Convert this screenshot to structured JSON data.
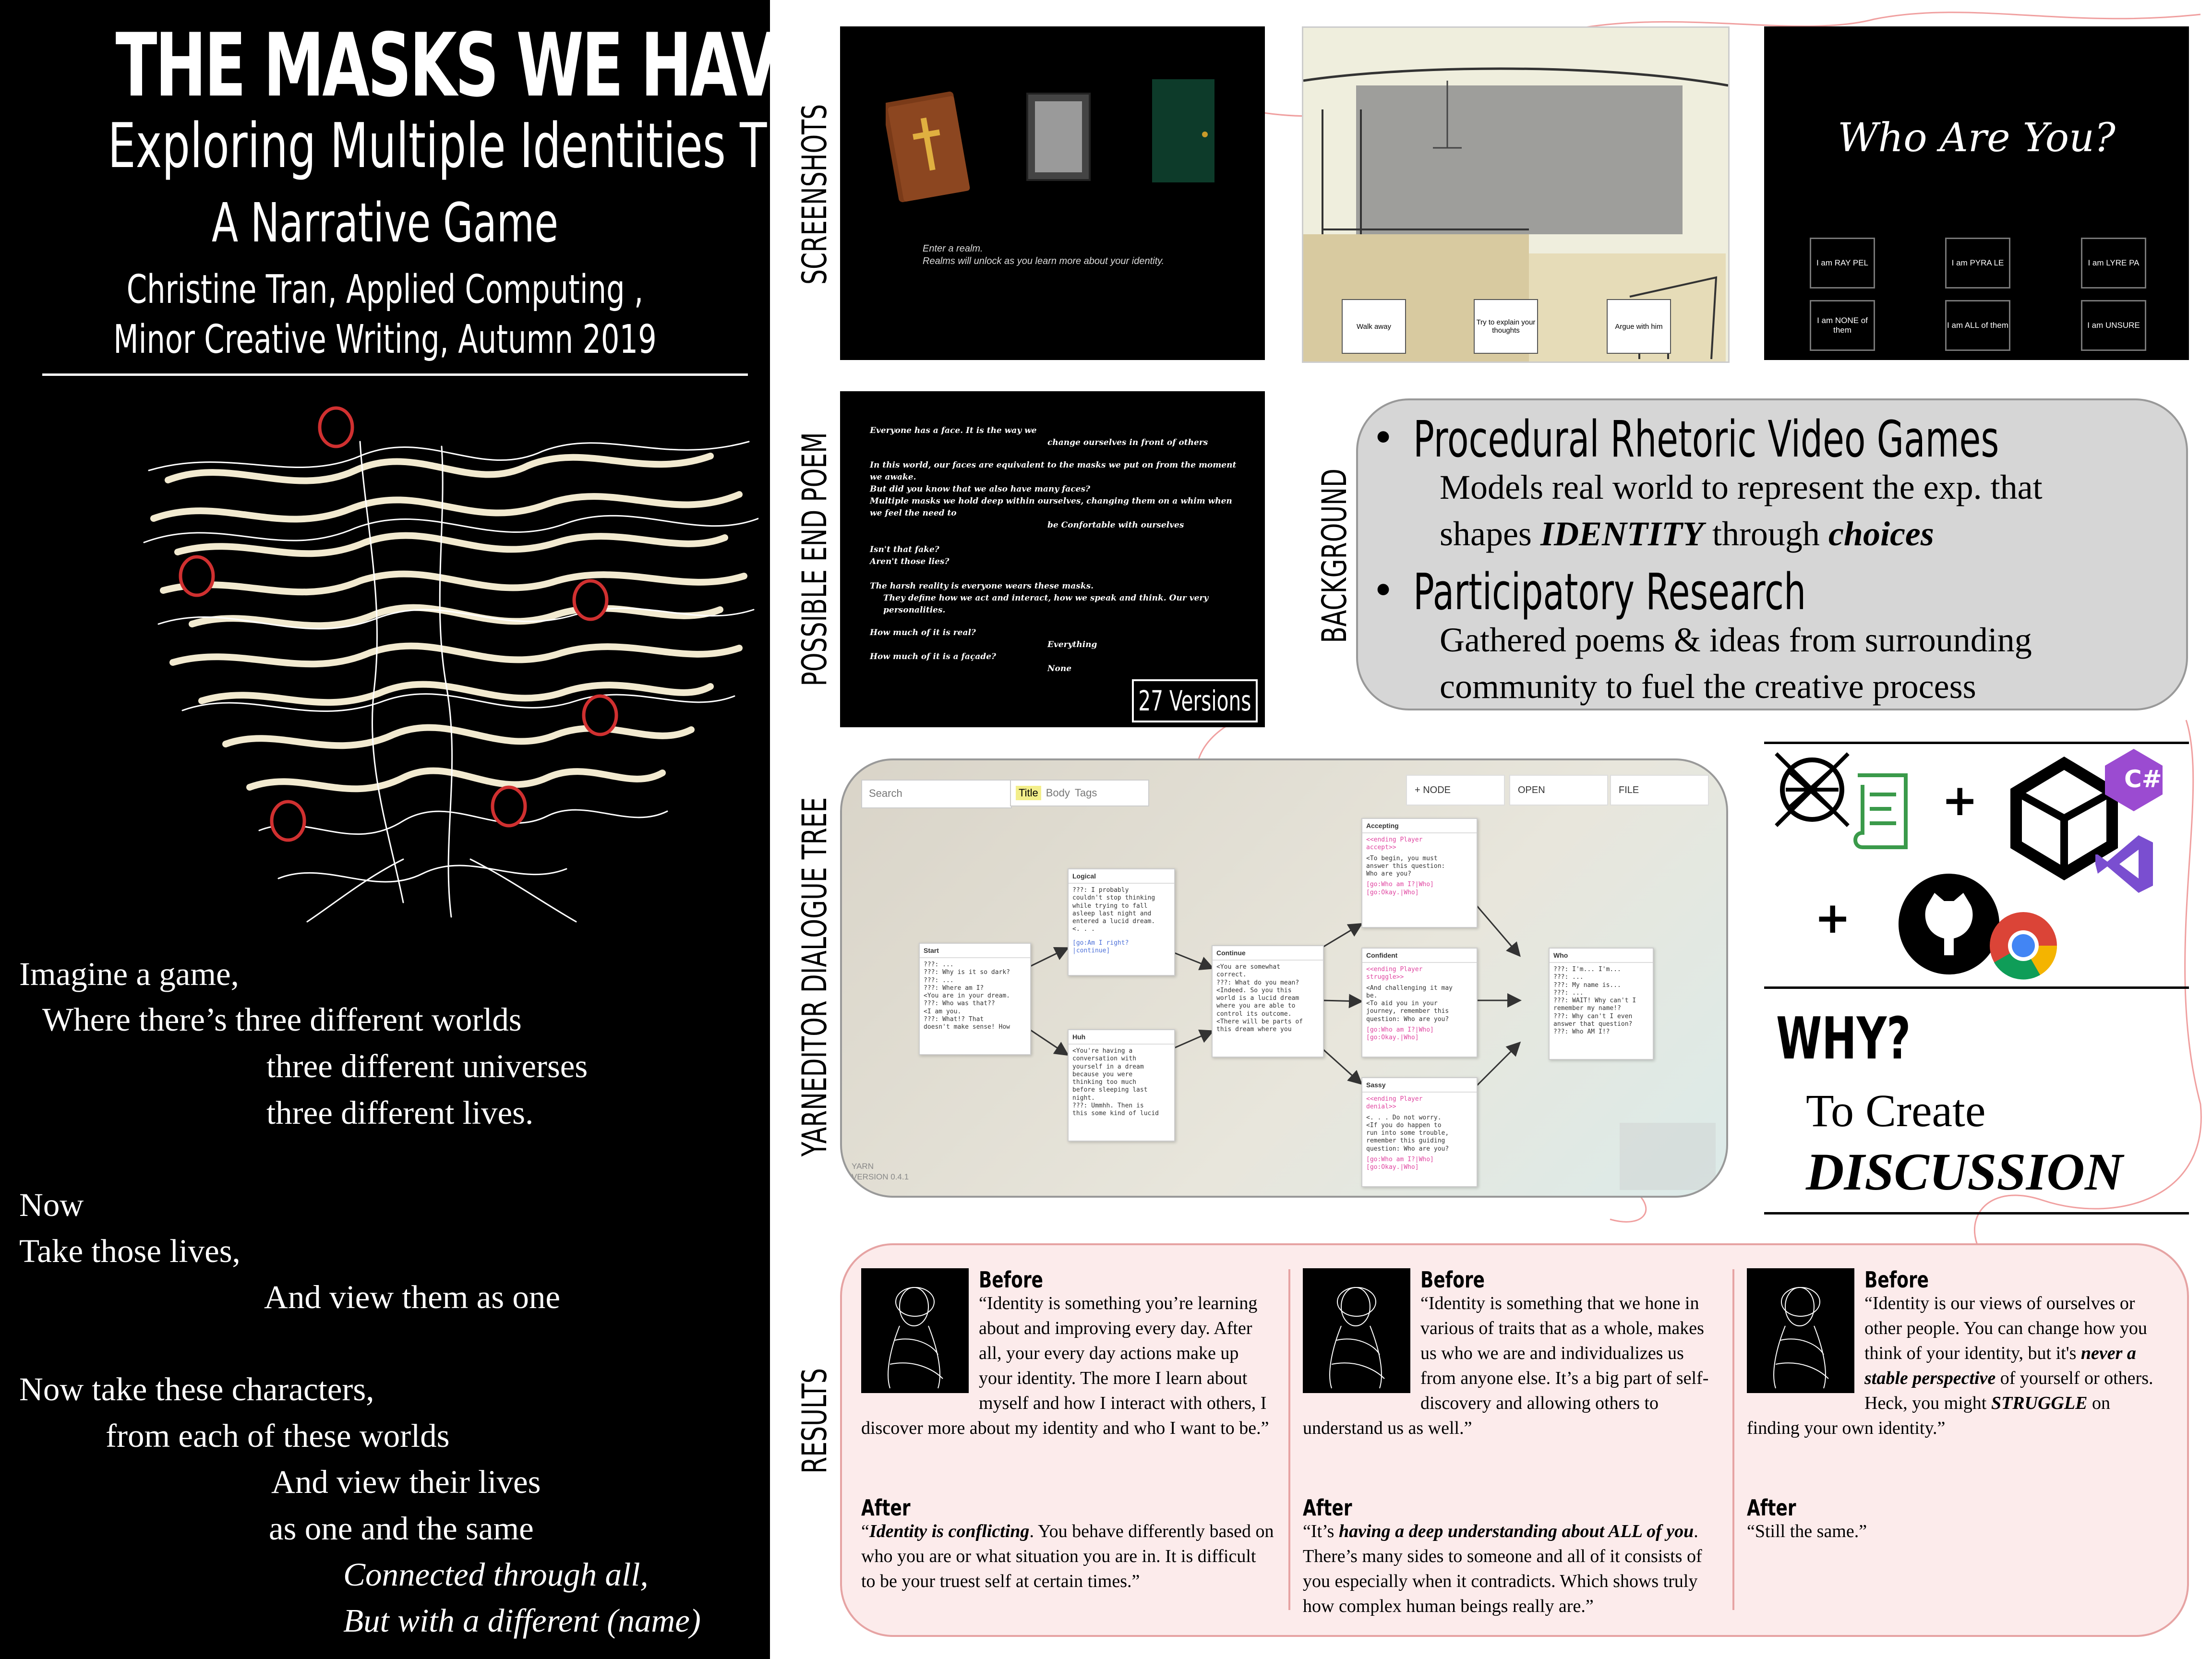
{
  "title": "THE MASKS WE HAVE",
  "subtitle_line1": "Exploring Multiple Identities Through",
  "subtitle_line2": "A Narrative Game",
  "author_line1": "Christine Tran, Applied Computing ,",
  "author_line2": "Minor Creative Writing, Autumn 2019",
  "poem": [
    {
      "text": "Imagine a game,",
      "italic": false
    },
    {
      "text": "Where there’s three different worlds",
      "italic": false
    },
    {
      "text": "three different universes",
      "italic": false
    },
    {
      "text": "three different lives.",
      "italic": false
    },
    {
      "text": "Now",
      "italic": false
    },
    {
      "text": "Take those lives,",
      "italic": false
    },
    {
      "text": "And view them as one",
      "italic": false
    },
    {
      "text": "Now take these characters,",
      "italic": false
    },
    {
      "text": "from each of these worlds",
      "italic": false
    },
    {
      "text": "And view their lives",
      "italic": false
    },
    {
      "text": "as one and the same",
      "italic": false
    },
    {
      "text": "Connected through all,",
      "italic": true
    },
    {
      "text": "But with a different (name)",
      "italic": true
    }
  ],
  "section_labels": {
    "screenshots": "SCREENSHOTS",
    "end_poem": "POSSIBLE END POEM",
    "background": "BACKGROUND",
    "dialogue_tree": "YARNEDITOR DIALOGUE TREE",
    "results": "RESULTS"
  },
  "screenshot1": {
    "caption": "Enter a realm.\nRealms will unlock as you learn more about your identity."
  },
  "screenshot2": {
    "choices": [
      "Walk away",
      "Try to explain your thoughts",
      "Argue with him"
    ]
  },
  "screenshot3": {
    "heading": "Who Are You?",
    "buttons": [
      "I am RAY PEL",
      "I am PYRA LE",
      "I am LYRE PA",
      "I am NONE of them",
      "I am ALL of them",
      "I am UNSURE"
    ]
  },
  "end_poem": {
    "lines": [
      "Everyone has a face. It is the way we",
      "change ourselves in front of others",
      "In this world, our faces are equivalent to the masks we put on from the moment we awake.",
      "But did you know that we also have many faces?",
      "Multiple masks we hold deep within ourselves, changing them on a whim when we feel the need to",
      "be Confortable with ourselves",
      "Isn't that fake?",
      "Aren't those lies?",
      "The harsh reality is everyone wears these masks.",
      "They define how we act and interact, how we speak and think. Our very personalities.",
      "How much of it is real?",
      "Everything",
      "How much of it is a façade?",
      "None"
    ],
    "versions": "27 Versions"
  },
  "background": {
    "bullet1_title": "Procedural Rhetoric Video Games",
    "bullet1_line1": "Models real world to represent the exp. that",
    "bullet1_line2_pre": "shapes ",
    "bullet1_line2_em1": "IDENTITY",
    "bullet1_line2_mid": " through ",
    "bullet1_line2_em2": "choices",
    "bullet2_title": "Participatory Research",
    "bullet2_line1": "Gathered poems & ideas from surrounding",
    "bullet2_line2": "community to fuel the creative process"
  },
  "yarn": {
    "search_placeholder": "Search",
    "filters": [
      "Title",
      "Body",
      "Tags"
    ],
    "buttons": [
      "+ NODE",
      "OPEN",
      "FILE"
    ],
    "version_line1": "YARN",
    "version_line2": "VERSION 0.4.1",
    "nodes": [
      {
        "id": "start",
        "title": "Start",
        "body": "???: ...\n???: Why is it so dark?\n???: ...\n???: Where am I?\n<You are in your dream.\n???: Who was that??\n<I am you.\n???: What!? That\ndoesn't make sense! How"
      },
      {
        "id": "logical",
        "title": "Logical",
        "body": "???: I probably\ncouldn't stop thinking\nwhile trying to fall\nasleep last night and\nentered a lucid dream.\n<. . .",
        "link": "[go:Am I right?\n|continue]"
      },
      {
        "id": "huh",
        "title": "Huh",
        "body": "<You're having a\nconversation with\nyourself in a dream\nbecause you were\nthinking too much\nbefore sleeping last\nnight.\n???: Ummhh. Then is\nthis some kind of lucid"
      },
      {
        "id": "continue",
        "title": "Continue",
        "body": "<You are somewhat\ncorrect.\n???: What do you mean?\n<Indeed. So you this\nworld is a lucid dream\nwhere you are able to\ncontrol its outcome.\n<There will be parts of\nthis dream where you"
      },
      {
        "id": "accepting",
        "title": "Accepting",
        "tag": "<<ending Player\naccept>>",
        "body": "<To begin, you must\nanswer this question:\nWho are you?",
        "link": "[go:Who am I?|Who]\n[go:Okay.|Who]"
      },
      {
        "id": "confident",
        "title": "Confident",
        "tag": "<<ending Player\nstruggle>>",
        "body": "<And challenging it may\nbe.\n<To aid you in your\njourney, remember this\nquestion: Who are you?",
        "link": "[go:Who am I?|Who]\n[go:Okay.|Who]"
      },
      {
        "id": "sassy",
        "title": "Sassy",
        "tag": "<<ending Player\ndenial>>",
        "body": "<. . . Do not worry.\n<If you do happen to\nrun into some trouble,\nremember this guiding\nquestion: Who are you?",
        "link": "[go:Who am I?|Who]\n[go:Okay.|Who]"
      },
      {
        "id": "who",
        "title": "Who",
        "body": "???: I'm... I'm...\n???: ...\n???: My name is...\n???: ...\n???: WAIT! Why can't I\nremember my name!?\n???: Why can't I even\nanswer that question?\n???: Who AM I!?"
      }
    ]
  },
  "tools": {
    "icons": [
      "yarn-ball-icon",
      "dialogue-scroll-icon",
      "unity-icon",
      "csharp-icon",
      "visual-studio-icon",
      "github-icon",
      "chrome-icon"
    ],
    "plus": "+"
  },
  "why": {
    "heading": "WHY?",
    "line1": "To Create",
    "line2": "DISCUSSION"
  },
  "results": [
    {
      "before_label": "Before",
      "before_text": "“Identity is something you’re learning about and improving every day.  After all, your every day actions make up your identity. The more I learn about myself and how I interact with others, I discover more about my identity and who I want to be.”",
      "after_label": "After",
      "after_em": "Identity is conflicting",
      "after_text": ". You behave differently based on who you are or what situation you are in. It is difficult to be your truest self at certain times.”"
    },
    {
      "before_label": "Before",
      "before_text": "“Identity is something that we hone in various of traits that as a whole, makes us who we are and individualizes us from anyone else. It’s a big part of self-discovery and allowing others to understand us as well.”",
      "after_label": "After",
      "after_pre": "“It’s ",
      "after_em": "having a deep understanding about ALL of you",
      "after_text": ". There’s many sides to someone and all of it consists of you especially when it contradicts. Which shows truly how complex human beings really are.”"
    },
    {
      "before_label": "Before",
      "before_pre": "“Identity is our views of ourselves or other people. You can change how you think of your identity, but it's ",
      "before_em1": "never a stable perspective",
      "before_mid": " of  yourself or others. Heck, you might ",
      "before_em2": "STRUGGLE",
      "before_post": " on finding your own identity.”",
      "after_label": "After",
      "after_text": "“Still the same.”"
    }
  ],
  "colors": {
    "accent_red": "#e0303a",
    "panel_gray": "#d6d6d6",
    "results_pink": "#fcebeb",
    "node_pink": "#e044a0",
    "node_blue": "#4a6ed8"
  }
}
